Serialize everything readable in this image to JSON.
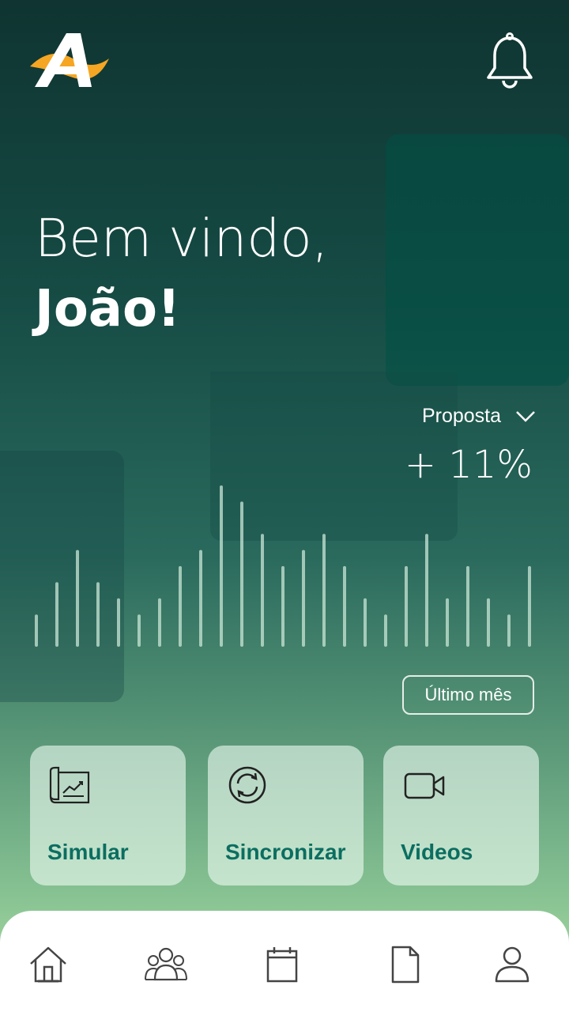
{
  "app": {
    "logo_icon": "brand-logo-icon",
    "notifications_icon": "bell-icon"
  },
  "welcome": {
    "greeting": "Bem vindo,",
    "name": "João!"
  },
  "metric": {
    "selected": "Proposta",
    "dropdown_icon": "chevron-down-icon",
    "value": "+ 11%",
    "period_button": "Último mês"
  },
  "chart_data": {
    "type": "bar",
    "values": [
      2,
      4,
      6,
      4,
      3,
      2,
      3,
      5,
      6,
      10,
      9,
      7,
      5,
      6,
      7,
      5,
      3,
      2,
      5,
      7,
      3,
      5,
      3,
      2,
      5
    ],
    "color": "#c9e6d6"
  },
  "actions": [
    {
      "label": "Simular",
      "icon": "chart-presentation-icon"
    },
    {
      "label": "Sincronizar",
      "icon": "sync-icon"
    },
    {
      "label": "Videos",
      "icon": "video-camera-icon"
    }
  ],
  "bottom_nav": [
    {
      "icon": "home-icon"
    },
    {
      "icon": "users-icon"
    },
    {
      "icon": "calendar-icon"
    },
    {
      "icon": "document-icon"
    },
    {
      "icon": "profile-icon"
    }
  ],
  "colors": {
    "accent_green": "#0b6e60",
    "logo_orange": "#f5a623"
  }
}
